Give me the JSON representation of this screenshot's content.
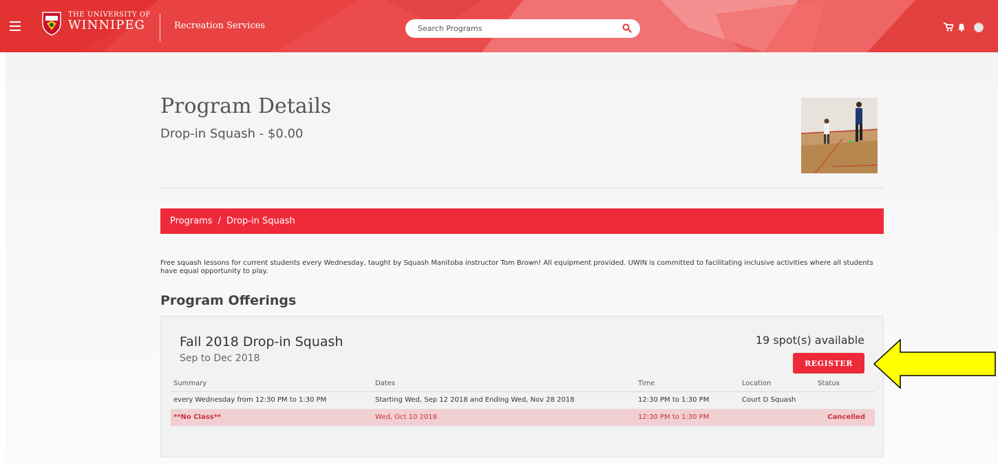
{
  "header": {
    "university_line1": "THE UNIVERSITY OF",
    "university_line2": "WINNIPEG",
    "section": "Recreation Services",
    "search_placeholder": "Search Programs",
    "icons": [
      "menu-icon",
      "crest-logo",
      "search-icon",
      "cart-icon",
      "bell-icon",
      "avatar"
    ],
    "colors": {
      "header_red": "#e63535",
      "accent_red": "#ee2a3a"
    }
  },
  "page": {
    "title": "Program Details",
    "subtitle": "Drop-in Squash - $0.00"
  },
  "breadcrumb": {
    "items": [
      "Programs",
      "Drop-in Squash"
    ],
    "separator": "/"
  },
  "description": "Free squash lessons for current students every Wednesday, taught by Squash Manitoba instructor Tom Brown! All equipment provided. UWIN is committed to facilitating inclusive activities where all students have equal opportunity to play.",
  "offerings": {
    "title": "Program Offerings",
    "card": {
      "name": "Fall 2018 Drop-in Squash",
      "dates": "Sep to Dec 2018",
      "spots": "19 spot(s) available",
      "register_label": "REGISTER",
      "columns": [
        "Summary",
        "Dates",
        "Time",
        "Location",
        "Status"
      ],
      "rows": [
        {
          "summary": "every Wednesday from 12:30 PM to 1:30 PM",
          "dates": "Starting Wed, Sep 12 2018 and Ending Wed, Nov 28 2018",
          "time": "12:30 PM to 1:30 PM",
          "location": "Court D Squash",
          "status": ""
        },
        {
          "summary": "**No Class**",
          "dates": "Wed, Oct 10 2018",
          "time": "12:30 PM to 1:30 PM",
          "location": "",
          "status": "Cancelled"
        }
      ]
    }
  },
  "annotation": {
    "arrow_color": "#ffff00"
  }
}
